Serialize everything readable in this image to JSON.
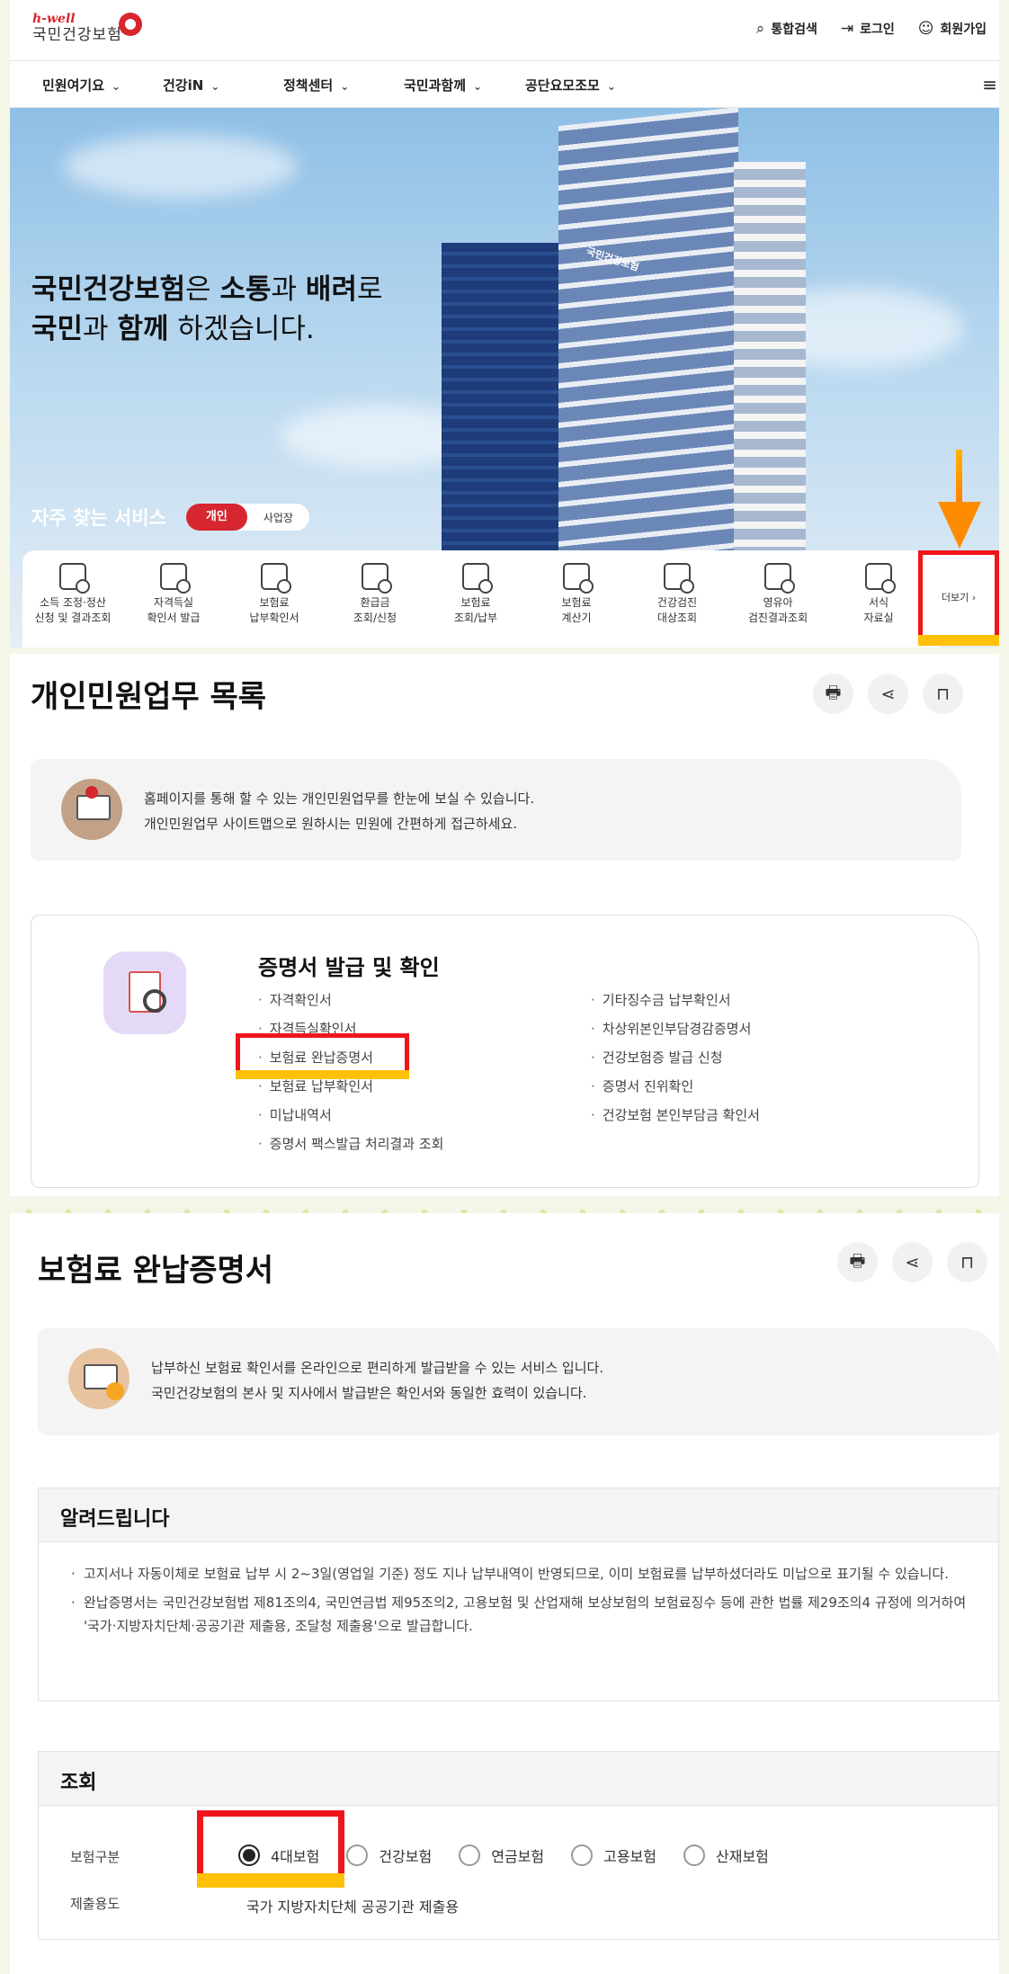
{
  "header": {
    "logo_top": "h-well",
    "logo_name": "국민건강보험",
    "util": [
      {
        "icon": "search-icon",
        "glyph": "⌕",
        "label": "통합검색"
      },
      {
        "icon": "login-icon",
        "glyph": "⇥",
        "label": "로그인"
      },
      {
        "icon": "user-add-icon",
        "glyph": "☺",
        "label": "회원가입"
      }
    ],
    "gnb": [
      "민원여기요",
      "건강iN",
      "정책센터",
      "국민과함께",
      "공단요모조모"
    ],
    "chev": "⌄",
    "menu_glyph": "≡"
  },
  "hero": {
    "line1_b1": "국민건강보험",
    "line1_t1": "은 ",
    "line1_b2": "소통",
    "line1_t2": "과 ",
    "line1_b3": "배려",
    "line1_t3": "로",
    "line2_b1": "국민",
    "line2_t1": "과 ",
    "line2_b2": "함께",
    "line2_t2": " 하겠습니다.",
    "sign": "국민건강보험"
  },
  "frequent": {
    "label": "자주 찾는 서비스",
    "toggle_on": "개인",
    "toggle_off": "사업장",
    "items": [
      {
        "l1": "소득 조정·정산",
        "l2": "신청 및 결과조회"
      },
      {
        "l1": "자격득실",
        "l2": "확인서 발급"
      },
      {
        "l1": "보험료",
        "l2": "납부확인서"
      },
      {
        "l1": "환급금",
        "l2": "조회/신청"
      },
      {
        "l1": "보험료",
        "l2": "조회/납부"
      },
      {
        "l1": "보험료",
        "l2": "계산기"
      },
      {
        "l1": "건강검진",
        "l2": "대상조회"
      },
      {
        "l1": "영유아",
        "l2": "검진결과조회"
      },
      {
        "l1": "서식",
        "l2": "자료실"
      }
    ],
    "more": "더보기 ›"
  },
  "list_page": {
    "title": "개인민원업무 목록",
    "tools": [
      "🖶",
      "⋖",
      "⊓"
    ],
    "info_l1": "홈페이지를 통해 할 수 있는 개인민원업무를 한눈에 보실 수 있습니다.",
    "info_l2": "개인민원업무 사이트맵으로 원하시는 민원에 간편하게 접근하세요.",
    "category": "증명서 발급 및 확인",
    "left": [
      "자격확인서",
      "자격득실확인서",
      "보험료 완납증명서",
      "보험료 납부확인서",
      "미납내역서",
      "증명서 팩스발급 처리결과 조회"
    ],
    "right": [
      "기타징수금 납부확인서",
      "차상위본인부담경감증명서",
      "건강보험증 발급 신청",
      "증명서 진위확인",
      "건강보험 본인부담금 확인서"
    ]
  },
  "cert_page": {
    "title": "보험료 완납증명서",
    "info_l1": "납부하신 보험료 확인서를 온라인으로 편리하게 발급받을 수 있는 서비스 입니다.",
    "info_l2": "국민건강보험의 본사 및 지사에서 발급받은 확인서와 동일한 효력이 있습니다.",
    "notice_title": "알려드립니다",
    "notice": [
      "고지서나 자동이체로 보험료 납부 시 2~3일(영업일 기준) 정도 지나 납부내역이 반영되므로, 이미 보험료를 납부하셨더라도 미납으로 표기될 수 있습니다.",
      "완납증명서는 국민건강보험법 제81조의4, 국민연금법 제95조의2, 고용보험 및 산업재해 보상보험의 보험료징수 등에 관한 법률 제29조의4 규정에 의거하여 '국가·지방자치단체·공공기관 제출용, 조달청 제출용'으로 발급합니다."
    ],
    "query_title": "조회",
    "type_label": "보험구분",
    "types": [
      "4대보험",
      "건강보험",
      "연금보험",
      "고용보험",
      "산재보험"
    ],
    "selected_type": "4대보험",
    "purpose_label": "제출용도",
    "purpose_value": "국가 지방자치단체 공공기관 제출용"
  }
}
